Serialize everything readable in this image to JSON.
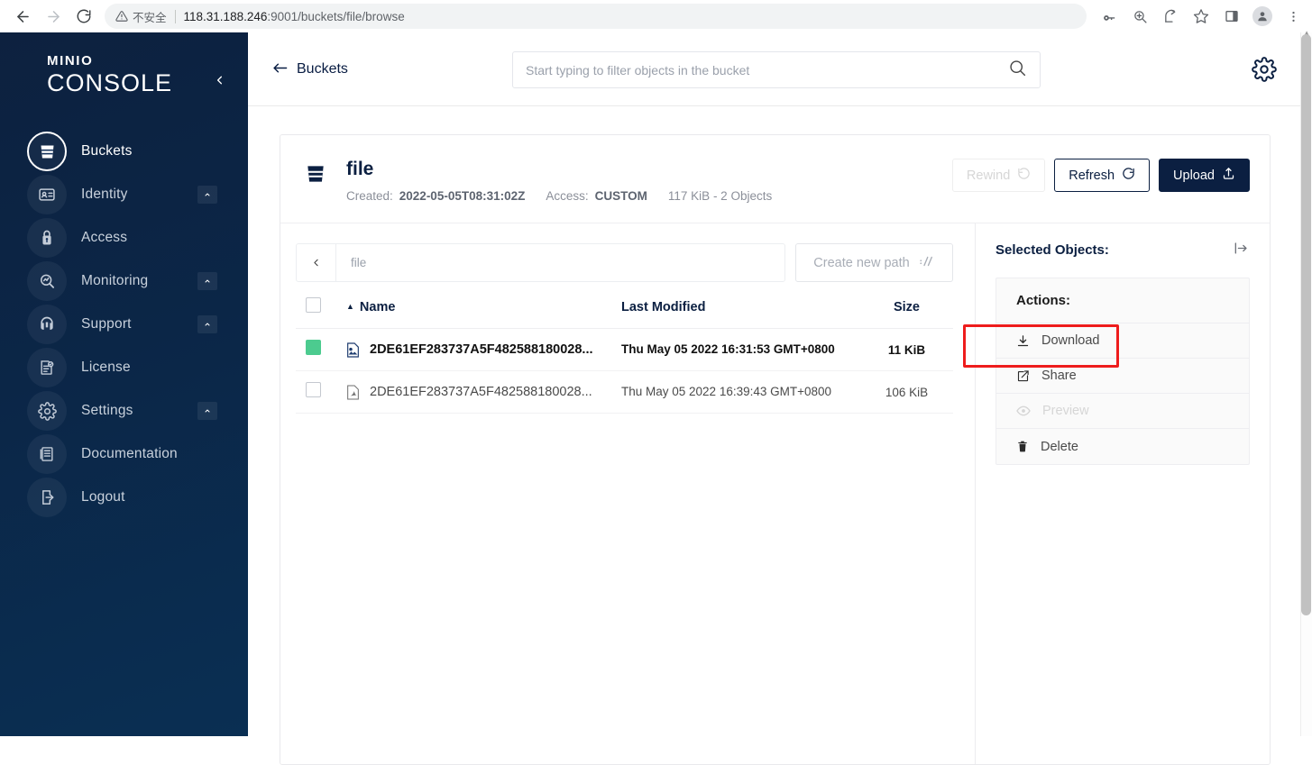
{
  "browser": {
    "back_icon": "arrow-left-icon",
    "forward_icon": "arrow-right-icon",
    "reload_icon": "reload-icon",
    "security_label": "不安全",
    "url_prefix": "118.31.188.246",
    "url_suffix": ":9001/buckets/file/browse",
    "url_full": "118.31.188.246:9001/buckets/file/browse",
    "actions": [
      {
        "name": "password-key-icon",
        "label": "Password manager"
      },
      {
        "name": "zoom-icon",
        "label": "Zoom"
      },
      {
        "name": "share-icon",
        "label": "Share this page"
      },
      {
        "name": "star-icon",
        "label": "Bookmark"
      },
      {
        "name": "side-panel-icon",
        "label": "Side panel"
      },
      {
        "name": "profile-icon",
        "label": "Profile"
      },
      {
        "name": "kebab-menu-icon",
        "label": "Customize and control"
      }
    ]
  },
  "sidebar": {
    "logo_top": "MINIO",
    "logo_bottom": "CONSOLE",
    "collapse_icon": "chevron-left-icon",
    "items": [
      {
        "label": "Buckets",
        "icon": "bucket-icon",
        "active": true,
        "expandable": false
      },
      {
        "label": "Identity",
        "icon": "identity-card-icon",
        "active": false,
        "expandable": true
      },
      {
        "label": "Access",
        "icon": "lock-icon",
        "active": false,
        "expandable": false
      },
      {
        "label": "Monitoring",
        "icon": "monitor-search-icon",
        "active": false,
        "expandable": true
      },
      {
        "label": "Support",
        "icon": "headset-icon",
        "active": false,
        "expandable": true
      },
      {
        "label": "License",
        "icon": "license-document-icon",
        "active": false,
        "expandable": false
      },
      {
        "label": "Settings",
        "icon": "gear-icon",
        "active": false,
        "expandable": true
      },
      {
        "label": "Documentation",
        "icon": "book-icon",
        "active": false,
        "expandable": false
      },
      {
        "label": "Logout",
        "icon": "logout-icon",
        "active": false,
        "expandable": false
      }
    ]
  },
  "topbar": {
    "back_label": "Buckets",
    "back_icon": "arrow-left-icon",
    "search_placeholder": "Start typing to filter objects in the bucket",
    "search_value": "",
    "search_icon": "search-icon",
    "settings_icon": "gear-icon"
  },
  "bucket": {
    "icon": "bucket-icon",
    "name": "file",
    "created_label": "Created:",
    "created_value": "2022-05-05T08:31:02Z",
    "access_label": "Access:",
    "access_value": "CUSTOM",
    "usage": "117 KiB - 2 Objects",
    "buttons": {
      "rewind": {
        "label": "Rewind",
        "icon": "rewind-icon",
        "disabled": true
      },
      "refresh": {
        "label": "Refresh",
        "icon": "refresh-icon",
        "disabled": false
      },
      "upload": {
        "label": "Upload",
        "icon": "upload-icon",
        "disabled": false
      }
    }
  },
  "browser_pane": {
    "path_back_icon": "chevron-left-icon",
    "path_value": "file",
    "create_path_label": "Create new path",
    "create_path_icon": "path-icon",
    "columns": {
      "name": "Name",
      "last_modified": "Last Modified",
      "size": "Size"
    },
    "sort_indicator": "▲",
    "rows": [
      {
        "selected": true,
        "icon": "image-file-icon",
        "name": "2DE61EF283737A5F482588180028...",
        "last_modified": "Thu May 05 2022 16:31:53 GMT+0800",
        "size": "11 KiB"
      },
      {
        "selected": false,
        "icon": "pdf-file-icon",
        "name": "2DE61EF283737A5F482588180028...",
        "last_modified": "Thu May 05 2022 16:39:43 GMT+0800",
        "size": "106 KiB"
      }
    ]
  },
  "right_panel": {
    "title": "Selected Objects:",
    "expand_icon": "expand-panel-icon",
    "actions_title": "Actions:",
    "actions": [
      {
        "label": "Download",
        "icon": "download-icon",
        "disabled": false,
        "highlighted": false
      },
      {
        "label": "Share",
        "icon": "share-external-icon",
        "disabled": false,
        "highlighted": true
      },
      {
        "label": "Preview",
        "icon": "eye-icon",
        "disabled": true,
        "highlighted": false
      },
      {
        "label": "Delete",
        "icon": "trash-icon",
        "disabled": false,
        "highlighted": false
      }
    ]
  },
  "colors": {
    "sidebar_dark": "#0b2647",
    "brand_navy": "#0b1f41",
    "selected_green": "#4ccb8f",
    "highlight_red": "#ee1c1c"
  }
}
